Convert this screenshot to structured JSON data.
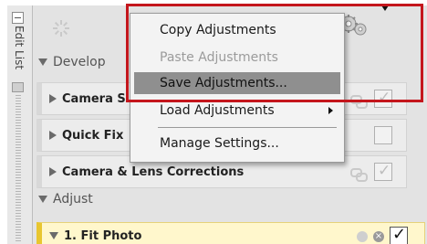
{
  "edit_list": {
    "label": "Edit List"
  },
  "sections": {
    "develop": "Develop",
    "adjust": "Adjust"
  },
  "rows": [
    {
      "label": "Camera S",
      "checked": true
    },
    {
      "label": "Quick Fix",
      "checked": false
    },
    {
      "label": "Camera & Lens Corrections",
      "checked": true
    }
  ],
  "fit_row": {
    "label": "1. Fit Photo",
    "checked": true
  },
  "menu": {
    "items": [
      {
        "label": "Copy Adjustments",
        "enabled": true
      },
      {
        "label": "Paste Adjustments",
        "enabled": false
      },
      {
        "label": "Save Adjustments...",
        "enabled": true,
        "highlighted": true
      },
      {
        "label": "Load Adjustments",
        "enabled": true,
        "submenu": true
      },
      {
        "label": "Manage Settings...",
        "enabled": true
      }
    ]
  },
  "colors": {
    "highlight_frame": "#c4161c",
    "active_row": "#fff7cc"
  },
  "icons": [
    "spinner-icon",
    "gear-icon",
    "chevron-down-icon",
    "link-icon",
    "close-icon",
    "check-icon"
  ]
}
